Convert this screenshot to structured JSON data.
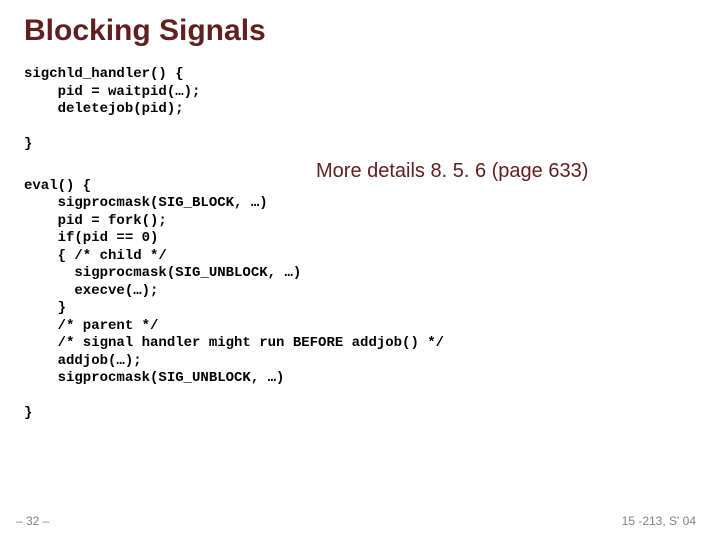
{
  "title": "Blocking Signals",
  "code1": "sigchld_handler() {\n    pid = waitpid(…);\n    deletejob(pid);\n\n}",
  "annotation": "More details 8. 5. 6 (page 633)",
  "code2": "eval() {\n    sigprocmask(SIG_BLOCK, …)\n    pid = fork();\n    if(pid == 0)\n    { /* child */\n      sigprocmask(SIG_UNBLOCK, …)\n      execve(…);\n    }\n    /* parent */\n    /* signal handler might run BEFORE addjob() */\n    addjob(…);\n    sigprocmask(SIG_UNBLOCK, …)\n\n}",
  "page_num": "– 32 –",
  "course": "15 -213, S' 04"
}
